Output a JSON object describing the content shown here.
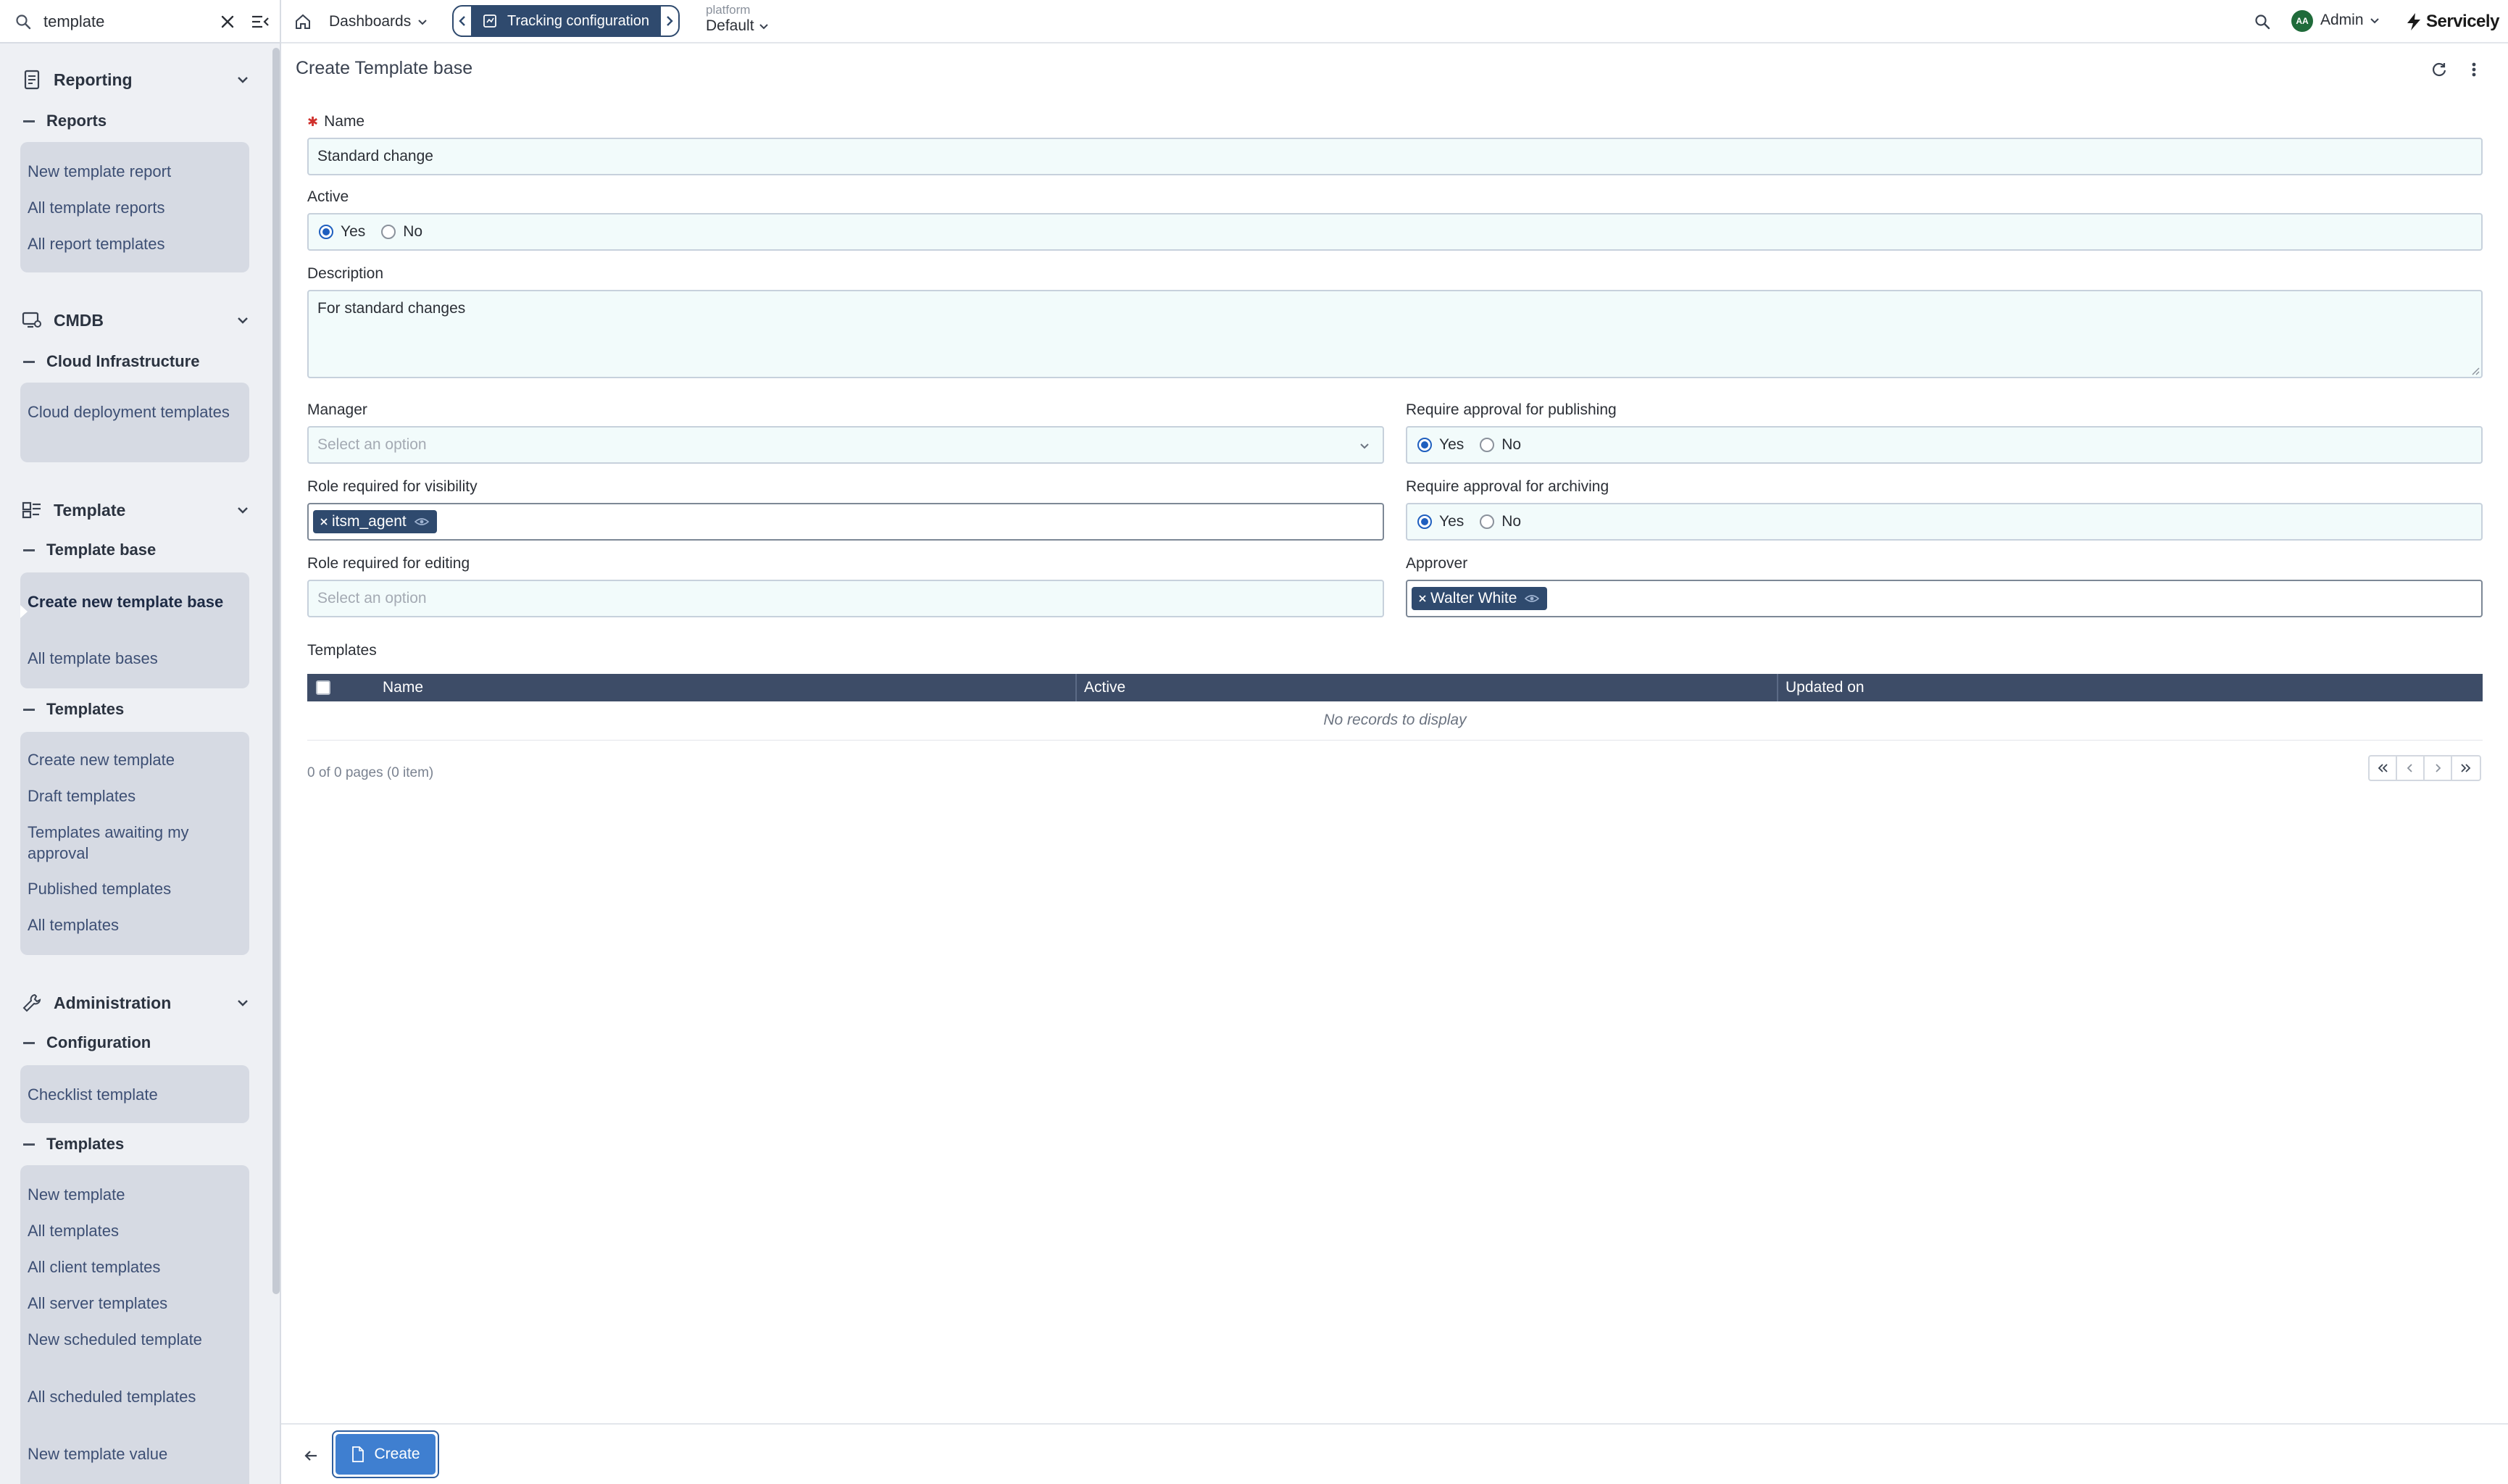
{
  "sidebar": {
    "search_value": "template",
    "sections": {
      "reporting": {
        "title": "Reporting",
        "sub": "Reports",
        "items": [
          "New template report",
          "All template reports",
          "All report templates"
        ]
      },
      "cmdb": {
        "title": "CMDB",
        "sub": "Cloud Infrastructure",
        "items": [
          "Cloud deployment templates"
        ]
      },
      "template": {
        "title": "Template",
        "sub1": "Template base",
        "items1": [
          "Create new template base",
          "All template bases"
        ],
        "sub2": "Templates",
        "items2": [
          "Create new template",
          "Draft templates",
          "Templates awaiting my approval",
          "Published templates",
          "All templates"
        ]
      },
      "administration": {
        "title": "Administration",
        "sub1": "Configuration",
        "items1": [
          "Checklist template"
        ],
        "sub2": "Templates",
        "items2": [
          "New template",
          "All templates",
          "All client templates",
          "All server templates",
          "New scheduled template",
          "All scheduled templates",
          "New template value"
        ]
      }
    }
  },
  "topbar": {
    "dashboards": "Dashboards",
    "active_tab": "Tracking configuration",
    "platform_label": "platform",
    "platform_value": "Default",
    "user_initials": "AA",
    "user_name": "Admin",
    "brand": "Servicely"
  },
  "form": {
    "title": "Create Template base",
    "name": {
      "label": "Name",
      "value": "Standard change"
    },
    "active": {
      "label": "Active",
      "yes": "Yes",
      "no": "No",
      "selected": "Yes"
    },
    "description": {
      "label": "Description",
      "value": "For standard changes"
    },
    "manager": {
      "label": "Manager",
      "placeholder": "Select an option"
    },
    "require_publishing": {
      "label": "Require approval for publishing",
      "yes": "Yes",
      "no": "No",
      "selected": "Yes"
    },
    "role_visibility": {
      "label": "Role required for visibility",
      "chip": "itsm_agent"
    },
    "require_archiving": {
      "label": "Require approval for archiving",
      "yes": "Yes",
      "no": "No",
      "selected": "Yes"
    },
    "role_editing": {
      "label": "Role required for editing",
      "placeholder": "Select an option"
    },
    "approver": {
      "label": "Approver",
      "chip": "Walter White"
    }
  },
  "templates_table": {
    "caption": "Templates",
    "columns": [
      "Name",
      "Active",
      "Updated on"
    ],
    "empty_text": "No records to display",
    "pager_info": "0 of 0 pages (0 item)"
  },
  "footer": {
    "create_label": "Create"
  },
  "colors": {
    "accent_navy": "#2f4a6e",
    "table_header": "#3d4c67",
    "primary_button": "#3f7fd0",
    "field_bg": "#f2fbfb",
    "sidebar_group": "#d6dae3",
    "required": "#d0312d"
  },
  "icons": {
    "sidebar_search": "search-icon",
    "clear": "close-icon",
    "collapse": "collapse-menu-icon",
    "reporting": "report-icon",
    "cmdb": "cmdb-icon",
    "template": "template-icon",
    "administration": "wrench-icon",
    "home": "home-icon",
    "refresh": "refresh-icon",
    "more": "more-vertical-icon",
    "back": "arrow-left-icon",
    "create": "file-icon"
  }
}
